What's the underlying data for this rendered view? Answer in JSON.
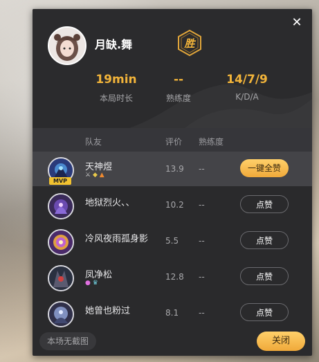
{
  "player": {
    "name": "月缺.舞",
    "result_badge": "胜"
  },
  "stats": [
    {
      "value": "19min",
      "label": "本局时长"
    },
    {
      "value": "--",
      "label": "熟练度"
    },
    {
      "value": "14/7/9",
      "label": "K/D/A"
    }
  ],
  "table": {
    "headers": {
      "teammate": "队友",
      "rating": "评价",
      "proficiency": "熟练度"
    },
    "rows": [
      {
        "name": "天神煜",
        "rating": "13.9",
        "proficiency": "--",
        "action": "一键全赞",
        "mvp": "MVP",
        "highlight": true
      },
      {
        "name": "地狱烈火、、",
        "rating": "10.2",
        "proficiency": "--",
        "action": "点赞"
      },
      {
        "name": "冷风夜雨孤身影",
        "rating": "5.5",
        "proficiency": "--",
        "action": "点赞"
      },
      {
        "name": "凤净松",
        "rating": "12.8",
        "proficiency": "--",
        "action": "点赞"
      },
      {
        "name": "她曾也粉过",
        "rating": "8.1",
        "proficiency": "--",
        "action": "点赞"
      }
    ]
  },
  "footer": {
    "no_screenshot": "本场无截图",
    "close": "关闭"
  },
  "colors": {
    "accent": "#f2b43a",
    "panel_bg": "#2a2a2c"
  }
}
